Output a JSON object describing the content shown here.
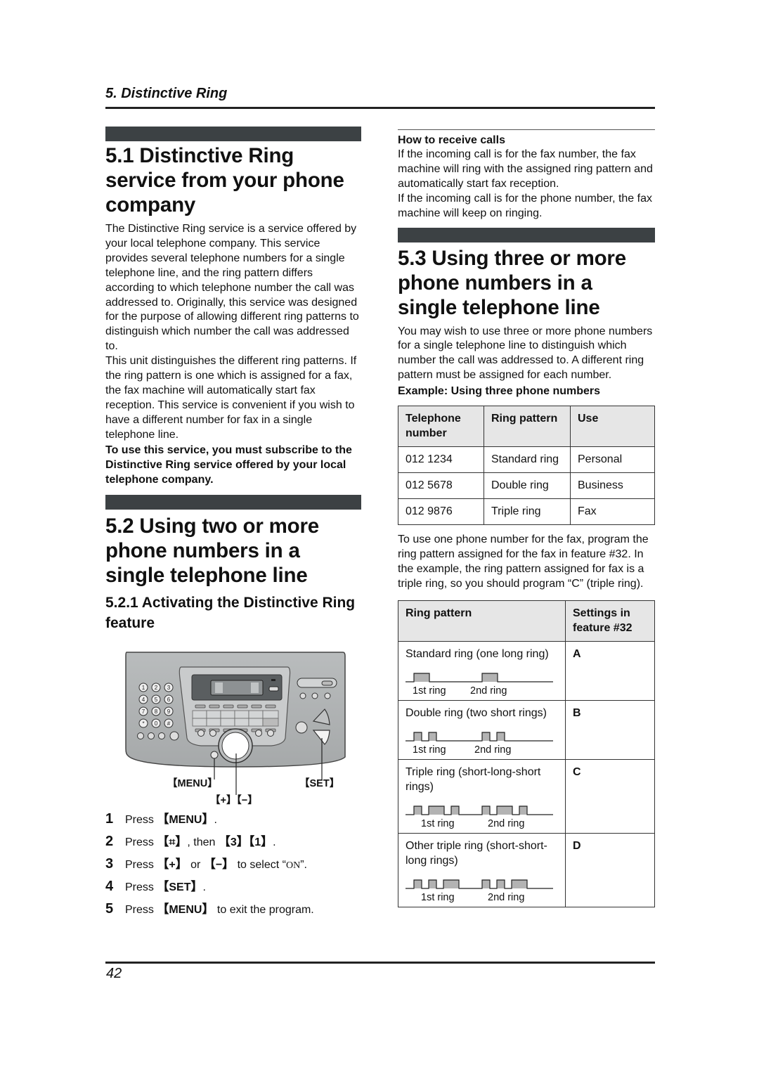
{
  "header": {
    "running_title": "5. Distinctive Ring"
  },
  "section_5_1": {
    "title": "5.1 Distinctive Ring service from your phone company",
    "para1": "The Distinctive Ring service is a service offered by your local telephone company. This service provides several telephone numbers for a single telephone line, and the ring pattern differs according to which telephone number the call was addressed to. Originally, this service was designed for the purpose of allowing different ring patterns to distinguish which number the call was addressed to.",
    "para2": "This unit distinguishes the different ring patterns. If the ring pattern is one which is assigned for a fax, the fax machine will automatically start fax reception. This service is convenient if you wish to have a different number for fax in a single telephone line.",
    "note_bold": "To use this service, you must subscribe to the Distinctive Ring service offered by your local telephone company."
  },
  "section_5_2": {
    "title": "5.2 Using two or more phone numbers in a single telephone line",
    "subsection_title": "5.2.1 Activating the Distinctive Ring feature",
    "illustration": {
      "labels": {
        "menu": "MENU",
        "set": "SET",
        "plus": "+",
        "minus": "−"
      },
      "keypad": [
        "1",
        "2",
        "3",
        "4",
        "5",
        "6",
        "7",
        "8",
        "9",
        "*",
        "0",
        "#"
      ]
    },
    "steps": [
      {
        "num": "1",
        "pre": "Press ",
        "keys": [
          "MENU"
        ],
        "post": "."
      },
      {
        "num": "2",
        "pre": "Press ",
        "keys": [
          "⌗"
        ],
        "mid": ", then ",
        "keys2": [
          "3",
          "1"
        ],
        "post": "."
      },
      {
        "num": "3",
        "pre": "Press ",
        "keys": [
          "+"
        ],
        "mid": " or ",
        "keys2": [
          "−"
        ],
        "post_pre": " to select “",
        "lcd": "ON",
        "post": "”."
      },
      {
        "num": "4",
        "pre": "Press ",
        "keys": [
          "SET"
        ],
        "post": "."
      },
      {
        "num": "5",
        "pre": "Press ",
        "keys": [
          "MENU"
        ],
        "post": " to exit the program."
      }
    ]
  },
  "how_to_receive": {
    "heading": "How to receive calls",
    "para1": "If the incoming call is for the fax number, the fax machine will ring with the assigned ring pattern and automatically start fax reception.",
    "para2": "If the incoming call is for the phone number, the fax machine will keep on ringing."
  },
  "section_5_3": {
    "title": "5.3 Using three or more phone numbers in a single telephone line",
    "para1": "You may wish to use three or more phone numbers for a single telephone line to distinguish which number the call was addressed to. A different ring pattern must be assigned for each number.",
    "example_heading": "Example: Using three phone numbers",
    "example_table": {
      "headers": [
        "Telephone number",
        "Ring pattern",
        "Use"
      ],
      "rows": [
        [
          "012 1234",
          "Standard ring",
          "Personal"
        ],
        [
          "012 5678",
          "Double ring",
          "Business"
        ],
        [
          "012 9876",
          "Triple ring",
          "Fax"
        ]
      ]
    },
    "para2": "To use one phone number for the fax, program the ring pattern assigned for the fax in feature #32. In the example, the ring pattern assigned for fax is a triple ring, so you should program “C” (triple ring).",
    "settings_table": {
      "headers": [
        "Ring pattern",
        "Settings in feature #32"
      ],
      "rows": [
        {
          "label": "Standard ring (one long ring)",
          "setting": "A",
          "pattern": [
            "long"
          ],
          "ring_labels": [
            "1st ring",
            "2nd ring"
          ]
        },
        {
          "label": "Double ring (two short rings)",
          "setting": "B",
          "pattern": [
            "short",
            "short"
          ],
          "ring_labels": [
            "1st ring",
            "2nd ring"
          ]
        },
        {
          "label": "Triple ring (short-long-short rings)",
          "setting": "C",
          "pattern": [
            "short",
            "long",
            "short"
          ],
          "ring_labels": [
            "1st ring",
            "2nd ring"
          ]
        },
        {
          "label": "Other triple ring (short-short-long rings)",
          "setting": "D",
          "pattern": [
            "short",
            "short",
            "long"
          ],
          "ring_labels": [
            "1st ring",
            "2nd ring"
          ]
        }
      ]
    }
  },
  "footer": {
    "page_number": "42"
  }
}
